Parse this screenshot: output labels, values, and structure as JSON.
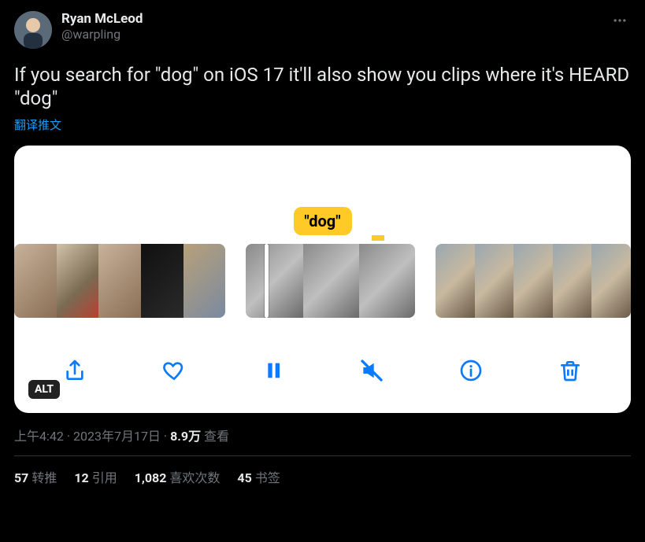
{
  "author": {
    "display_name": "Ryan McLeod",
    "handle": "@warpling"
  },
  "tweet_text": "If you search for \"dog\" on iOS 17 it'll also show you clips where it's HEARD \"dog\"",
  "translate_label": "翻译推文",
  "media": {
    "bubble_text": "\"dog\"",
    "alt_label": "ALT"
  },
  "meta": {
    "time": "上午4:42",
    "sep1": " · ",
    "date": "2023年7月17日",
    "sep2": " · ",
    "views_count": "8.9万",
    "views_label": " 查看"
  },
  "stats": {
    "retweets_n": "57",
    "retweets_l": "转推",
    "quotes_n": "12",
    "quotes_l": "引用",
    "likes_n": "1,082",
    "likes_l": "喜欢次数",
    "bookmarks_n": "45",
    "bookmarks_l": "书签"
  }
}
